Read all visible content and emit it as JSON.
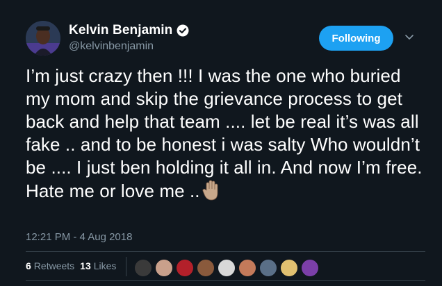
{
  "author": {
    "display_name": "Kelvin Benjamin",
    "handle": "@kelvinbenjamin",
    "verified": true,
    "avatar_icon": "profile-photo"
  },
  "follow_button": {
    "label": "Following"
  },
  "menu_icon": "chevron-down-icon",
  "tweet": {
    "text": "I’m just crazy then !!! I was the one who buried my mom and skip the grievance process to get back and help that team .... let be real it’s was all  fake .. and to be honest i was salty Who wouldn’t be .... I just ben holding it all in. And now I’m free. Hate me or love me ..",
    "emoji": "raised-hand-icon",
    "timestamp": "12:21 PM - 4 Aug 2018"
  },
  "stats": {
    "retweets_count": "6",
    "retweets_label": "Retweets",
    "likes_count": "13",
    "likes_label": "Likes"
  },
  "likers": [
    {
      "color": "#3a3a3a"
    },
    {
      "color": "#c9a08b"
    },
    {
      "color": "#b3202a"
    },
    {
      "color": "#8a5a3c"
    },
    {
      "color": "#d8d8d8"
    },
    {
      "color": "#c47a5a"
    },
    {
      "color": "#5a6f87"
    },
    {
      "color": "#e0c070"
    },
    {
      "color": "#7b3fa8"
    }
  ],
  "colors": {
    "background": "#10171e",
    "accent": "#1da1f2",
    "secondary_text": "#8899a6"
  }
}
